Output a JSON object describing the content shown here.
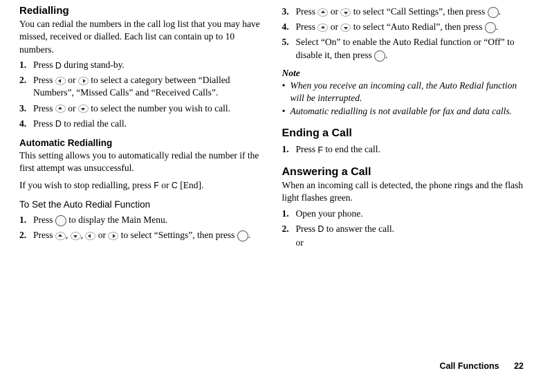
{
  "left": {
    "h_redialling": "Redialling",
    "redialling_intro": "You can redial the numbers in the call log list that you may have missed, received or dialled. Each list can contain up to 10 numbers.",
    "steps1": {
      "s1a": "Press ",
      "s1b": " during stand-by.",
      "s2a": "Press ",
      "s2b": " or ",
      "s2c": " to select a category between “Dialled Numbers”, “Missed Calls” and “Received Calls”.",
      "s3a": "Press ",
      "s3b": " or ",
      "s3c": " to select the number you wish to call.",
      "s4a": "Press ",
      "s4b": " to redial the call."
    },
    "h_auto": "Automatic Redialling",
    "auto_intro1": "This setting allows you to automatically redial the number if the first attempt was unsuccessful.",
    "auto_intro2a": "If you wish to stop redialling, press ",
    "auto_intro2b": " or ",
    "auto_intro2c": " [End].",
    "h_toset": "To Set the Auto Redial Function",
    "steps2": {
      "s1a": "Press ",
      "s1b": " to display the Main Menu.",
      "s2a": "Press ",
      "s2b": ", ",
      "s2c": ", ",
      "s2d": " or ",
      "s2e": " to select “Settings”, then press ",
      "s2f": "."
    }
  },
  "right": {
    "steps3": {
      "s3a": "Press ",
      "s3b": " or ",
      "s3c": " to select “Call Settings”, then press ",
      "s3d": ".",
      "s4a": "Press ",
      "s4b": " or ",
      "s4c": " to select “Auto Redial”, then press ",
      "s4d": ".",
      "s5a": "Select “On” to enable the Auto Redial function or “Off” to disable it, then press ",
      "s5b": "."
    },
    "note_head": "Note",
    "note1": "When you receive an incoming call, the Auto Redial function will be interrupted.",
    "note2": "Automatic redialling is not available for fax and data calls.",
    "h_ending": "Ending a Call",
    "end_s1a": "Press ",
    "end_s1b": " to end the call.",
    "h_answering": "Answering a Call",
    "answer_intro": "When an incoming call is detected, the phone rings and the flash light flashes green.",
    "ans_s1": "Open your phone.",
    "ans_s2a": "Press ",
    "ans_s2b": " to answer the call.",
    "or": "or"
  },
  "keys": {
    "D": "D",
    "F": "F",
    "C": "C"
  },
  "nums": {
    "n1": "1.",
    "n2": "2.",
    "n3": "3.",
    "n4": "4.",
    "n5": "5."
  },
  "bullet": "•",
  "footer": {
    "label": "Call Functions",
    "page": "22"
  }
}
